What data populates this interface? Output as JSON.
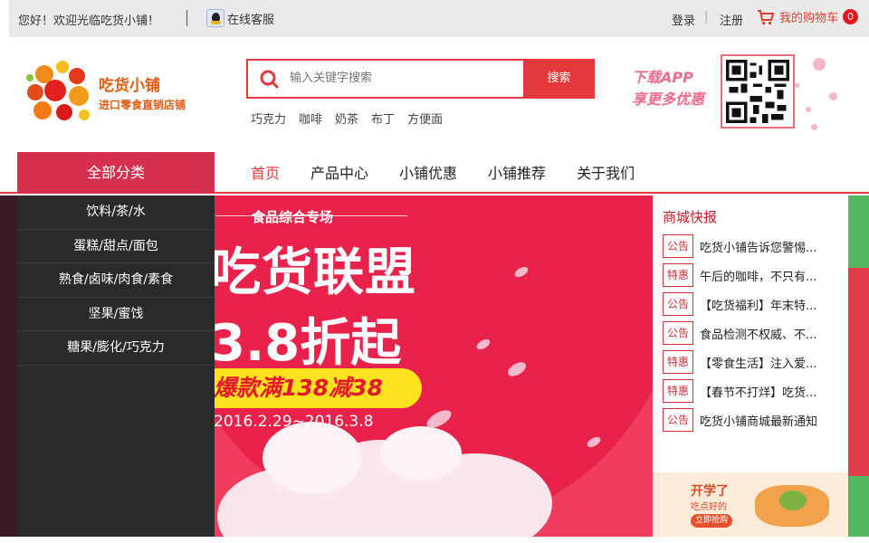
{
  "topbar": {
    "greeting": "您好！欢迎光临吃货小铺！",
    "service": "在线客服",
    "login": "登录",
    "divider": "|",
    "register": "注册",
    "cart_label": "我的购物车",
    "cart_count": "0"
  },
  "header": {
    "logo_name": "吃货小铺",
    "logo_slogan": "进口零食直销店铺",
    "search_placeholder": "输入关键字搜索",
    "search_button": "搜索",
    "hot_words": [
      "巧克力",
      "咖啡",
      "奶茶",
      "布丁",
      "方便面"
    ],
    "app_line1": "下载APP",
    "app_line2": "享更多优惠"
  },
  "nav": {
    "all_categories": "全部分类",
    "items": [
      {
        "label": "首页",
        "active": true
      },
      {
        "label": "产品中心",
        "active": false
      },
      {
        "label": "小铺优惠",
        "active": false
      },
      {
        "label": "小铺推荐",
        "active": false
      },
      {
        "label": "关于我们",
        "active": false
      }
    ]
  },
  "categories": [
    "饮料/茶/水",
    "蛋糕/甜点/面包",
    "熟食/卤味/肉食/素食",
    "坚果/蜜饯",
    "糖果/膨化/巧克力"
  ],
  "banner": {
    "heading": "食品综合专场",
    "headline1": "吃货联盟",
    "headline2": "3.8折起",
    "promo": "爆款满138减38",
    "date": "2016.2.29~2016.3.8"
  },
  "news": {
    "title": "商城快报",
    "items": [
      {
        "tag": "公告",
        "text": "吃货小铺告诉您警惕..."
      },
      {
        "tag": "特惠",
        "text": "午后的咖啡，不只有..."
      },
      {
        "tag": "公告",
        "text": "【吃货福利】年末特..."
      },
      {
        "tag": "公告",
        "text": "食品检测不权威、不..."
      },
      {
        "tag": "特惠",
        "text": "【零食生活】注入爱..."
      },
      {
        "tag": "特惠",
        "text": "【春节不打烊】吃货..."
      },
      {
        "tag": "公告",
        "text": "吃货小铺商城最新通知"
      }
    ]
  },
  "ad": {
    "line1": "开学了",
    "line2": "吃点好的",
    "button": "立即抢购"
  },
  "colors": {
    "accent": "#e4393c",
    "category_bar": "#d6304e",
    "banner_bg": "#f03d5e"
  }
}
